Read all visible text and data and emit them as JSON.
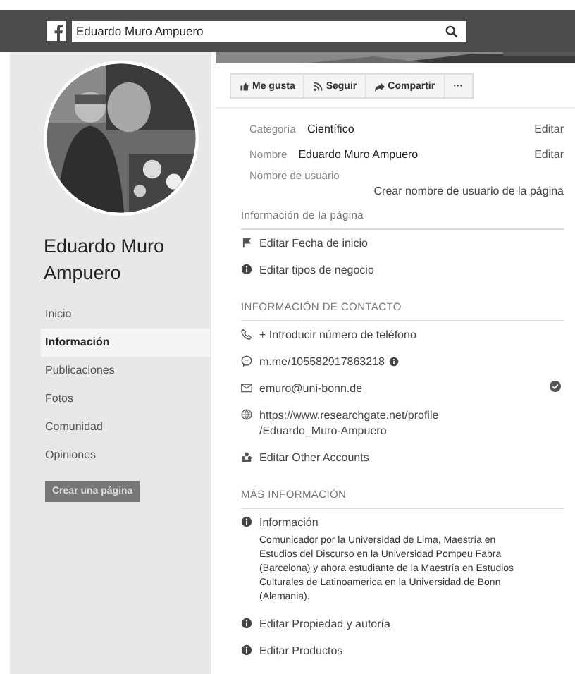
{
  "header": {
    "search_value": "Eduardo Muro Ampuero"
  },
  "sidebar": {
    "name": "Eduardo Muro Ampuero",
    "nav": [
      {
        "label": "Inicio",
        "selected": false
      },
      {
        "label": "Información",
        "selected": true
      },
      {
        "label": "Publicaciones",
        "selected": false
      },
      {
        "label": "Fotos",
        "selected": false
      },
      {
        "label": "Comunidad",
        "selected": false
      },
      {
        "label": "Opiniones",
        "selected": false
      }
    ],
    "create_button": "Crear una página"
  },
  "actions": [
    {
      "kind": "like",
      "label": "Me gusta"
    },
    {
      "kind": "follow",
      "label": "Seguir"
    },
    {
      "kind": "share",
      "label": "Compartir"
    },
    {
      "kind": "more",
      "label": "···"
    }
  ],
  "fields": [
    {
      "label": "Categoría",
      "value": "Científico",
      "action": "Editar"
    },
    {
      "label": "Nombre",
      "value": "Eduardo Muro Ampuero",
      "action": "Editar"
    }
  ],
  "username": {
    "label": "Nombre de usuario",
    "action": "Crear nombre de usuario de la página"
  },
  "sections": [
    {
      "title": "Información de la página",
      "items": [
        {
          "kind": "flag",
          "text": "Editar Fecha de inicio"
        },
        {
          "kind": "info",
          "text": "Editar tipos de negocio"
        }
      ]
    },
    {
      "title": "INFORMACIÓN DE CONTACTO",
      "items": [
        {
          "kind": "phone",
          "text": "+ Introducir número de teléfono"
        },
        {
          "kind": "messenger",
          "text": "m.me/105582917863218",
          "hint": true
        },
        {
          "kind": "mail",
          "text": "emuro@uni-bonn.de",
          "verified": true
        },
        {
          "kind": "globe",
          "text": "https://www.researchgate.net/profile\n/Eduardo_Muro-Ampuero"
        },
        {
          "kind": "accounts",
          "text": "Editar Other Accounts"
        }
      ]
    },
    {
      "title": "MÁS INFORMACIÓN",
      "items": [
        {
          "kind": "info",
          "text": "Información",
          "description": "Comunicador por la Universidad de Lima, Maestría en Estudios del Discurso en la Universidad Pompeu Fabra (Barcelona) y ahora estudiante de la Maestría en Estudios Culturales de Latinoamerica en la Universidad de Bonn (Alemania)."
        },
        {
          "kind": "info",
          "text": "Editar Propiedad y autoría"
        },
        {
          "kind": "info",
          "text": "Editar Productos"
        }
      ]
    }
  ]
}
